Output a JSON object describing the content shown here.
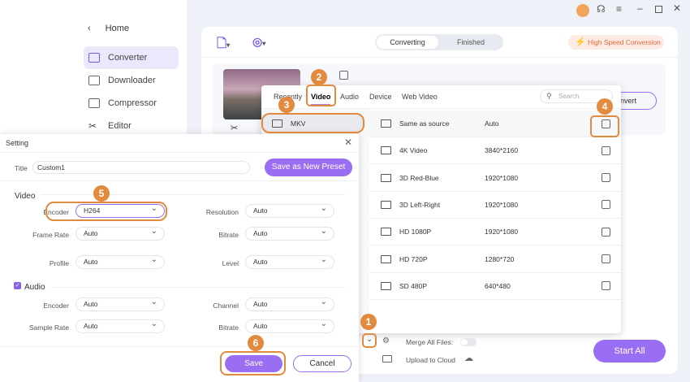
{
  "sidebar": {
    "home": "Home",
    "items": [
      {
        "label": "Converter",
        "active": true
      },
      {
        "label": "Downloader"
      },
      {
        "label": "Compressor"
      },
      {
        "label": "Editor"
      }
    ]
  },
  "header": {
    "tabs": [
      "Converting",
      "Finished"
    ],
    "high_speed": "High Speed Conversion"
  },
  "format_panel": {
    "tabs": [
      "Recently",
      "Video",
      "Audio",
      "Device",
      "Web Video"
    ],
    "active_tab": "Video",
    "search_placeholder": "Search",
    "formats": [
      "MKV"
    ],
    "presets": [
      {
        "name": "Same as source",
        "res": "Auto"
      },
      {
        "name": "4K Video",
        "res": "3840*2160"
      },
      {
        "name": "3D Red-Blue",
        "res": "1920*1080"
      },
      {
        "name": "3D Left-Right",
        "res": "1920*1080"
      },
      {
        "name": "HD 1080P",
        "res": "1920*1080"
      },
      {
        "name": "HD 720P",
        "res": "1280*720"
      },
      {
        "name": "SD 480P",
        "res": "640*480"
      }
    ]
  },
  "convert_partial": "nvert",
  "setting": {
    "title": "Setting",
    "title_label": "Title",
    "title_value": "Custom1",
    "save_preset": "Save as New Preset",
    "video_label": "Video",
    "audio_label": "Audio",
    "audio_checked": true,
    "video_fields": [
      {
        "label": "Encoder",
        "value": "H264"
      },
      {
        "label": "Resolution",
        "value": "Auto"
      },
      {
        "label": "Frame Rate",
        "value": "Auto"
      },
      {
        "label": "Bitrate",
        "value": "Auto"
      },
      {
        "label": "Profile",
        "value": "Auto"
      },
      {
        "label": "Level",
        "value": "Auto"
      }
    ],
    "audio_fields": [
      {
        "label": "Encoder",
        "value": "Auto"
      },
      {
        "label": "Channel",
        "value": "Auto"
      },
      {
        "label": "Sample Rate",
        "value": "Auto"
      },
      {
        "label": "Bitrate",
        "value": "Auto"
      }
    ],
    "save": "Save",
    "cancel": "Cancel"
  },
  "bottom": {
    "merge": "Merge All Files:",
    "merge_on": false,
    "upload": "Upload to Cloud",
    "start_all": "Start All"
  },
  "steps": [
    "1",
    "2",
    "3",
    "4",
    "5",
    "6"
  ],
  "colors": {
    "accent": "#9a6ef2",
    "step": "#e28a3e",
    "high_speed": "#e5683a"
  }
}
